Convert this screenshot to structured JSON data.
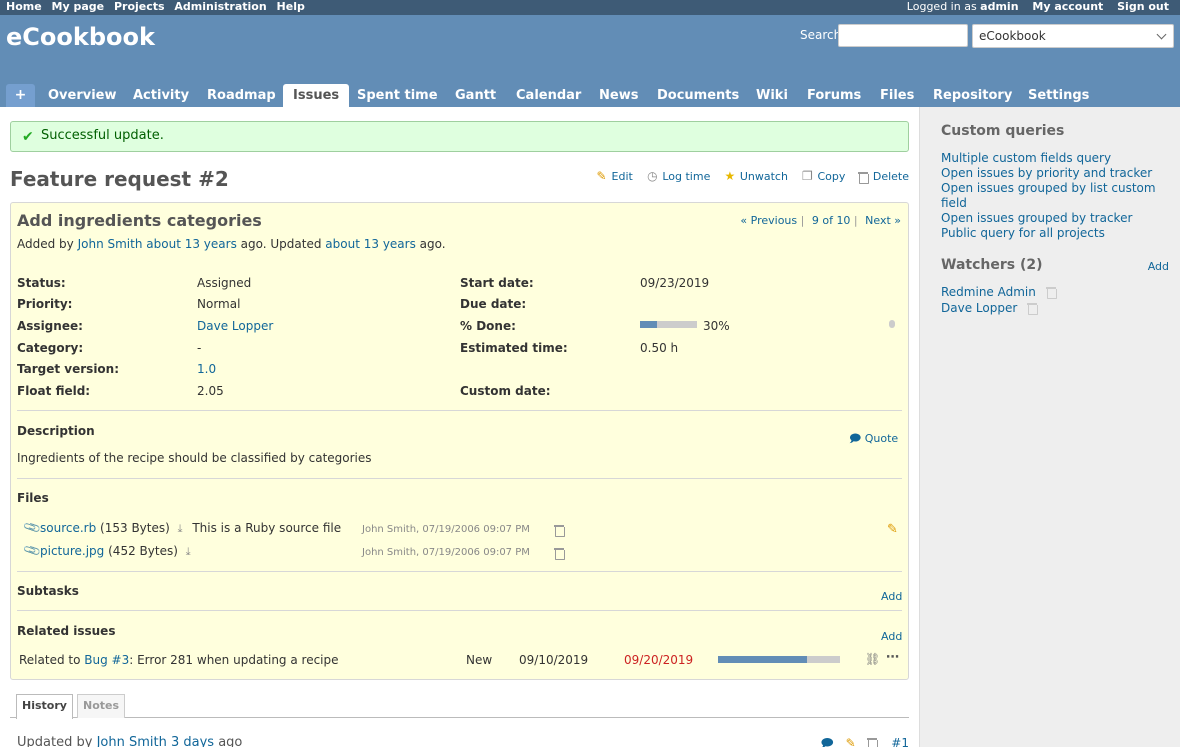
{
  "top_menu": {
    "left": [
      "Home",
      "My page",
      "Projects",
      "Administration",
      "Help"
    ],
    "logged_as_prefix": "Logged in as",
    "logged_as_user": "admin",
    "right": [
      "My account",
      "Sign out"
    ]
  },
  "header": {
    "title": "eCookbook",
    "search_label": "Search:",
    "search_value": "",
    "project_select": "eCookbook"
  },
  "main_menu": {
    "plus": "+",
    "tabs": [
      "Overview",
      "Activity",
      "Roadmap",
      "Issues",
      "Spent time",
      "Gantt",
      "Calendar",
      "News",
      "Documents",
      "Wiki",
      "Forums",
      "Files",
      "Repository",
      "Settings"
    ],
    "selected": "Issues"
  },
  "flash": "Successful update.",
  "issue": {
    "heading": "Feature request #2",
    "actions": [
      "Edit",
      "Log time",
      "Unwatch",
      "Copy",
      "Delete"
    ],
    "subject": "Add ingredients categories",
    "nav": {
      "previous": "« Previous",
      "position": "9 of 10",
      "next": "Next »"
    },
    "author": {
      "added_by": "Added by",
      "user": "John Smith",
      "added_ago": "about 13 years",
      "ago1": "ago. Updated",
      "updated_ago": "about 13 years",
      "ago2": "ago."
    },
    "attributes_left": [
      {
        "label": "Status:",
        "value": "Assigned"
      },
      {
        "label": "Priority:",
        "value": "Normal"
      },
      {
        "label": "Assignee:",
        "value": "Dave Lopper"
      },
      {
        "label": "Category:",
        "value": "-"
      },
      {
        "label": "Target version:",
        "value": "1.0"
      },
      {
        "label": "Float field:",
        "value": "2.05"
      }
    ],
    "attributes_right": [
      {
        "label": "Start date:",
        "value": "09/23/2019"
      },
      {
        "label": "Due date:",
        "value": ""
      },
      {
        "label": "% Done:",
        "value": "30%"
      },
      {
        "label": "Estimated time:",
        "value": "0.50 h"
      },
      {
        "label": "Custom date:",
        "value": ""
      }
    ],
    "done_ratio": 0.3,
    "description_title": "Description",
    "quote": "Quote",
    "description": "Ingredients of the recipe should be classified by categories",
    "files_title": "Files",
    "files": [
      {
        "name": "source.rb",
        "size": "(153 Bytes)",
        "desc": "This is a Ruby source file",
        "meta": "John Smith, 07/19/2006 09:07 PM"
      },
      {
        "name": "picture.jpg",
        "size": "(452 Bytes)",
        "desc": "",
        "meta": "John Smith, 07/19/2006 09:07 PM"
      }
    ],
    "subtasks_title": "Subtasks",
    "related_title": "Related issues",
    "add": "Add",
    "relation": {
      "prefix": "Related to",
      "issue": "Bug #3",
      "subject": ": Error 281 when updating a recipe",
      "status": "New",
      "start": "09/10/2019",
      "due": "09/20/2019",
      "done_ratio": 0.73
    }
  },
  "history_tabs": [
    "History",
    "Notes"
  ],
  "journal": {
    "prefix": "Updated by",
    "user": "John Smith",
    "ago": "3 days",
    "suffix": "ago",
    "number": "#1"
  },
  "sidebar": {
    "queries_title": "Custom queries",
    "queries": [
      "Multiple custom fields query",
      "Open issues by priority and tracker",
      "Open issues grouped by list custom field",
      "Open issues grouped by tracker",
      "Public query for all projects"
    ],
    "watchers_title": "Watchers (2)",
    "watchers_add": "Add",
    "watchers": [
      "Redmine Admin",
      "Dave Lopper"
    ]
  },
  "colors": {
    "header": "#628DB6",
    "top_menu": "#3E5B76",
    "issue_bg": "#ffffdd",
    "flash_bg": "#dfffdf",
    "overdue": "#c22"
  }
}
